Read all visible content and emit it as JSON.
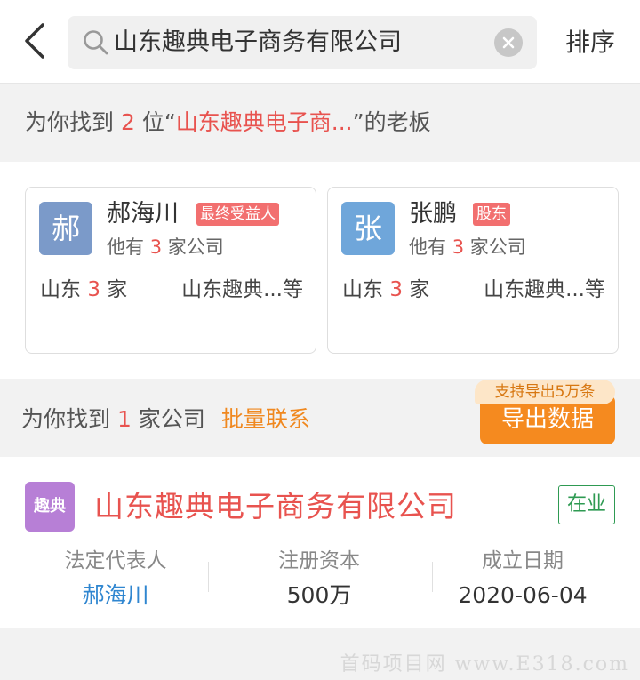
{
  "header": {
    "search_query": "山东趣典电子商务有限公司",
    "sort_label": "排序"
  },
  "boss_result": {
    "prefix": "为你找到",
    "count": "2",
    "middle": "位“",
    "keyword": "山东趣典电子商...",
    "suffix": "”的老板"
  },
  "bosses": [
    {
      "avatar_char": "郝",
      "avatar_color": "#7b9ac9",
      "name": "郝海川",
      "tag": "最终受益人",
      "sub_prefix": "他有",
      "company_count": "3",
      "sub_suffix": "家公司",
      "region": "山东",
      "region_count": "3",
      "region_unit": "家",
      "companies": "山东趣典...等"
    },
    {
      "avatar_char": "张",
      "avatar_color": "#6fa6da",
      "name": "张鹏",
      "tag": "股东",
      "sub_prefix": "他有",
      "company_count": "3",
      "sub_suffix": "家公司",
      "region": "山东",
      "region_count": "3",
      "region_unit": "家",
      "companies": "山东趣典...等"
    }
  ],
  "company_result": {
    "prefix": "为你找到",
    "count": "1",
    "suffix": "家公司",
    "batch_contact": "批量联系",
    "export_tip": "支持导出5万条",
    "export_label": "导出数据"
  },
  "company": {
    "logo_text": "趣典",
    "name": "山东趣典电子商务有限公司",
    "status": "在业",
    "stats": [
      {
        "label": "法定代表人",
        "value": "郝海川"
      },
      {
        "label": "注册资本",
        "value": "500万"
      },
      {
        "label": "成立日期",
        "value": "2020-06-04"
      }
    ]
  },
  "watermark": "首码项目网 www.E318.com",
  "colors": {
    "accent_red": "#e8534f",
    "accent_orange": "#f58a1f",
    "status_green": "#2e9a52",
    "link_blue": "#2f86d0"
  }
}
